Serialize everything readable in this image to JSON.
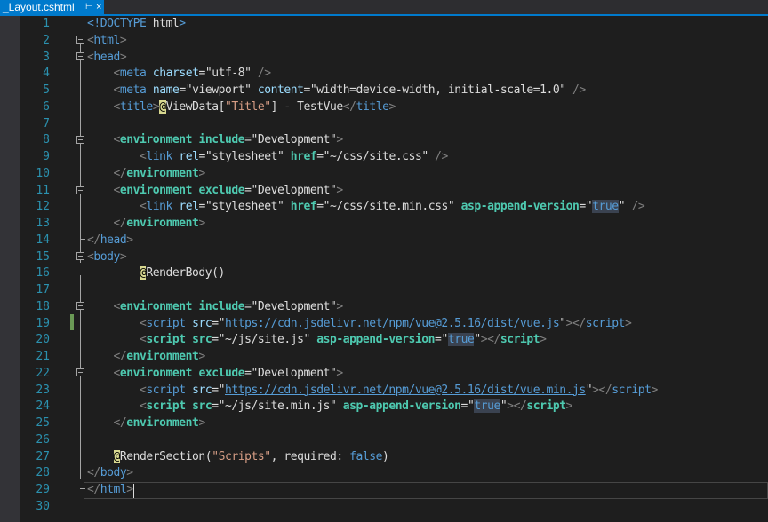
{
  "tab": {
    "title": "_Layout.cshtml",
    "pin": "⊢",
    "close": "×"
  },
  "lines": [
    "1",
    "2",
    "3",
    "4",
    "5",
    "6",
    "7",
    "8",
    "9",
    "10",
    "11",
    "12",
    "13",
    "14",
    "15",
    "16",
    "17",
    "18",
    "19",
    "20",
    "21",
    "22",
    "23",
    "24",
    "25",
    "26",
    "27",
    "28",
    "29",
    "30"
  ],
  "code": {
    "l1_doctype": "<!DOCTYPE",
    "l1_html": " html",
    "l1_end": ">",
    "l2": "html",
    "l3": "head",
    "l4_tag": "meta",
    "l4_attr": "charset",
    "l4_val": "\"utf-8\"",
    "l5_tag": "meta",
    "l5_attr1": "name",
    "l5_val1": "\"viewport\"",
    "l5_attr2": "content",
    "l5_val2": "\"width=device-width, initial-scale=1.0\"",
    "l6_tag": "title",
    "l6_at": "@",
    "l6_viewdata": "ViewData",
    "l6_key": "\"Title\"",
    "l6_rest": " - TestVue",
    "env_tag": "environment",
    "include": "include",
    "exclude": "exclude",
    "development": "\"Development\"",
    "link_tag": "link",
    "rel": "rel",
    "stylesheet": "\"stylesheet\"",
    "href": "href",
    "css_site": "\"~/css/site.css\"",
    "css_site_min": "\"~/css/site.min.css\"",
    "asp_append": "asp-append-version",
    "true": "true",
    "body": "body",
    "render_at": "@",
    "render_body": "RenderBody()",
    "script_tag": "script",
    "src": "src",
    "vue_js": "https://cdn.jsdelivr.net/npm/vue@2.5.16/dist/vue.js",
    "vue_min_js": "https://cdn.jsdelivr.net/npm/vue@2.5.16/dist/vue.min.js",
    "site_js": "\"~/js/site.js\"",
    "site_min_js": "\"~/js/site.min.js\"",
    "render_section": "RenderSection(",
    "scripts_str": "\"Scripts\"",
    "required": ", required: ",
    "false": "false",
    "close_paren": ")"
  }
}
